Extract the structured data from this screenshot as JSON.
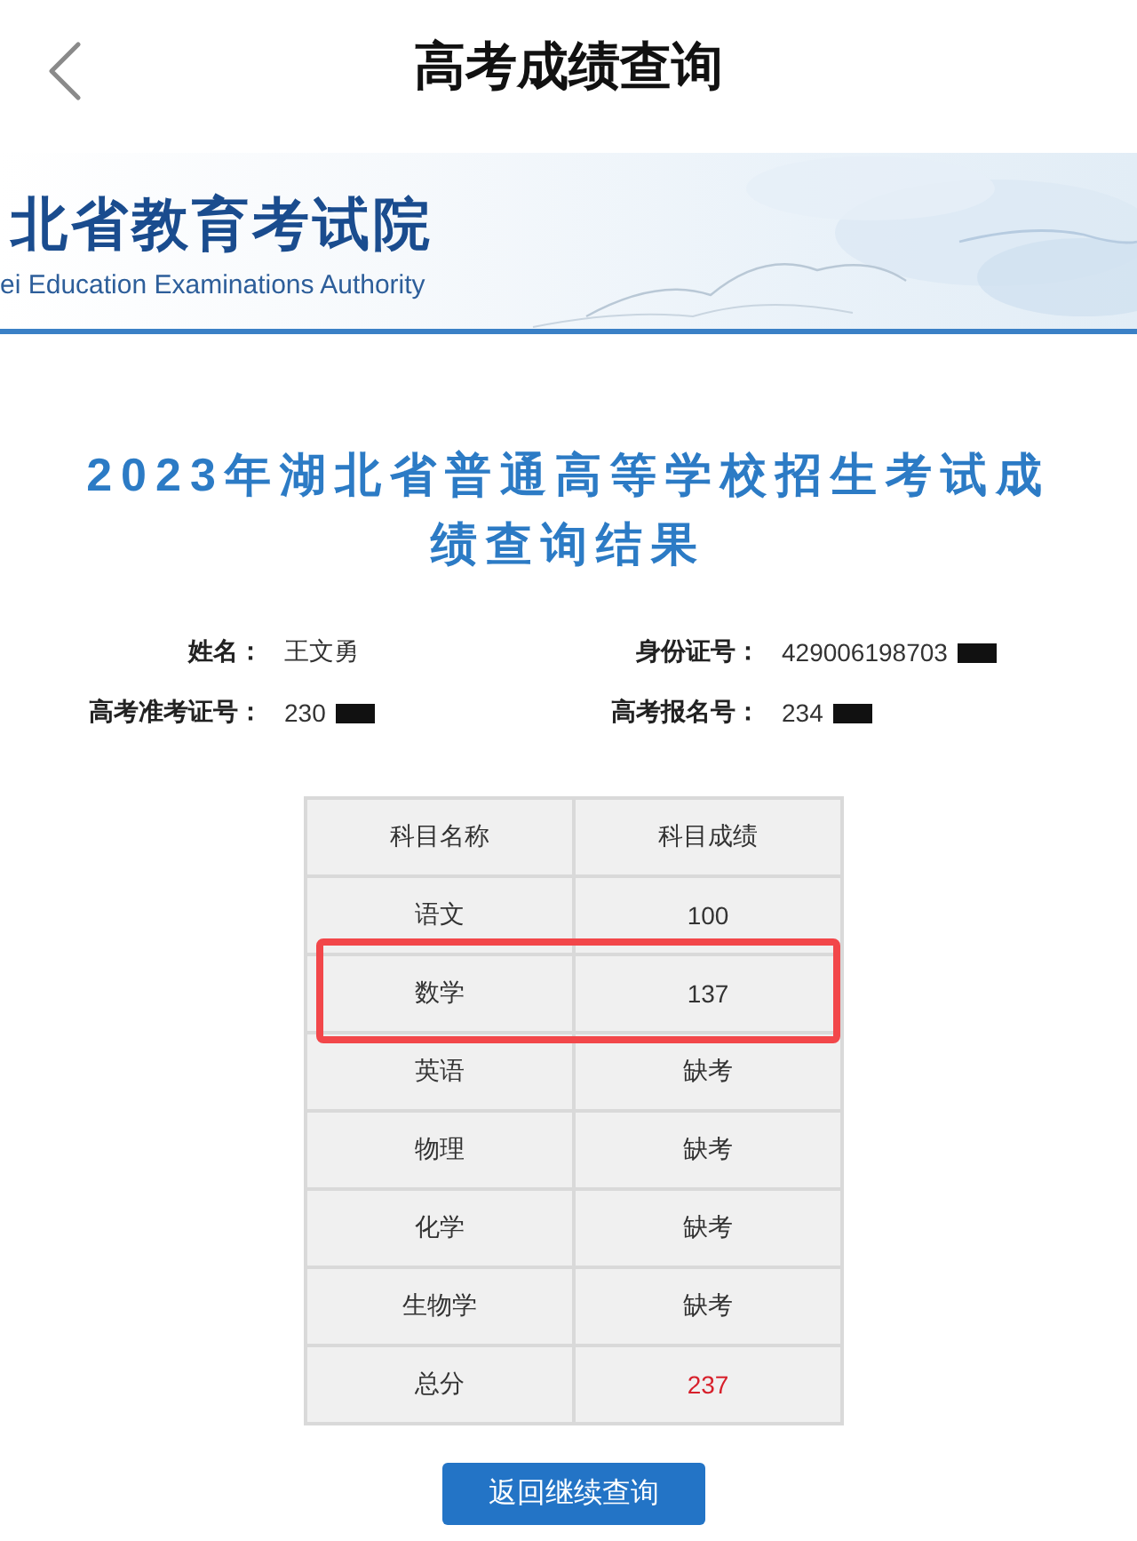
{
  "nav_bar": {
    "title": "高考成绩查询"
  },
  "banner": {
    "name": "北省教育考试院",
    "english_name": "ei Education Examinations Authority"
  },
  "heading": "2023年湖北省普通高等学校招生考试成绩查询结果",
  "info_fields": [
    {
      "label": "姓名：",
      "value": "王文勇",
      "redacted": false
    },
    {
      "label": "身份证号：",
      "value": "429006198703",
      "redacted": true
    },
    {
      "label": "高考准考证号：",
      "value": "230",
      "redacted": true
    },
    {
      "label": "高考报名号：",
      "value": "234",
      "redacted": true
    }
  ],
  "table": {
    "columns": [
      "科目名称",
      "科目成绩"
    ],
    "rows": [
      {
        "kind": "subject",
        "subject": "语文",
        "score": "100",
        "highlighted": false
      },
      {
        "kind": "subject",
        "subject": "数学",
        "score": "137",
        "highlighted": true
      },
      {
        "kind": "subject",
        "subject": "英语",
        "score": "缺考",
        "highlighted": false
      },
      {
        "kind": "subject",
        "subject": "物理",
        "score": "缺考",
        "highlighted": false
      },
      {
        "kind": "subject",
        "subject": "化学",
        "score": "缺考",
        "highlighted": false
      },
      {
        "kind": "subject",
        "subject": "生物学",
        "score": "缺考",
        "highlighted": false
      },
      {
        "kind": "total",
        "subject": "总分",
        "score": "237",
        "highlighted": false
      }
    ]
  },
  "button": "返回继续查询"
}
